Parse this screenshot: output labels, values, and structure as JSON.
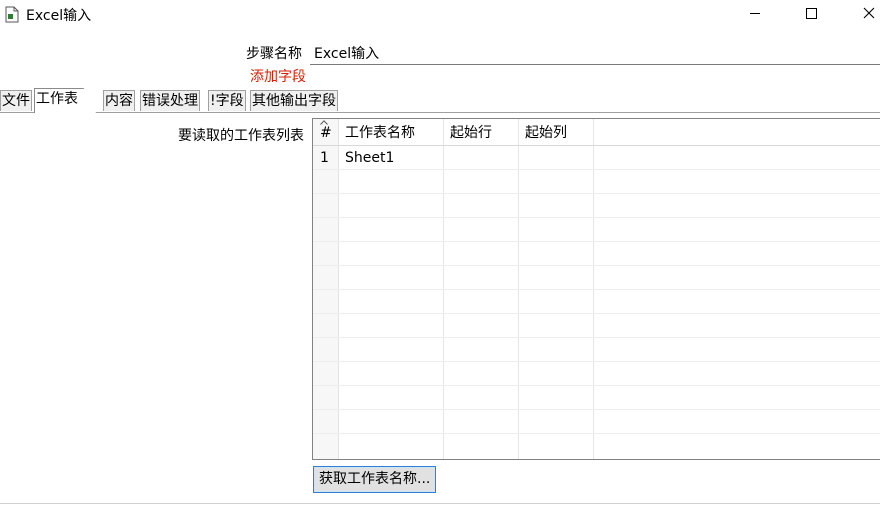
{
  "window": {
    "title": "Excel输入",
    "icon": "document-icon"
  },
  "form": {
    "step_name_label": "步骤名称",
    "step_name_value": "Excel输入",
    "add_field_label": "添加字段",
    "add_field_color": "#d81e06"
  },
  "tabs": [
    {
      "label": "文件",
      "active": false
    },
    {
      "label": "工作表",
      "active": true
    },
    {
      "label": "内容",
      "active": false
    },
    {
      "label": "错误处理",
      "active": false
    },
    {
      "label": "!字段",
      "active": false
    },
    {
      "label": "其他输出字段",
      "active": false
    }
  ],
  "sheets": {
    "label": "要读取的工作表列表",
    "columns": [
      "#",
      "工作表名称",
      "起始行",
      "起始列"
    ],
    "rows": [
      [
        "1",
        "Sheet1",
        "",
        ""
      ]
    ]
  },
  "buttons": {
    "get_sheet_names": "获取工作表名称..."
  }
}
